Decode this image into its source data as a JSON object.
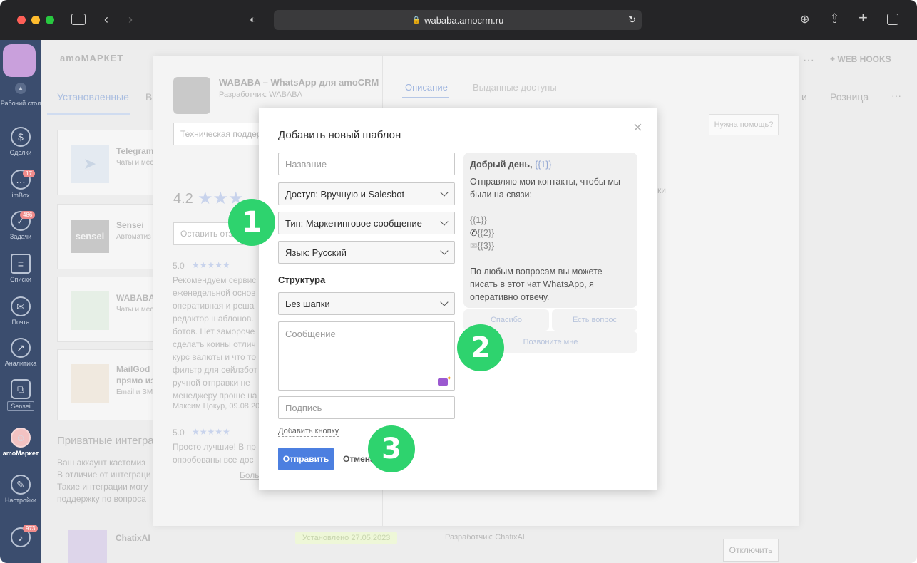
{
  "browser": {
    "url": "wababa.amocrm.ru"
  },
  "sidebar": {
    "items": [
      {
        "label": "Рабочий стол",
        "badge": ""
      },
      {
        "label": "Сделки",
        "badge": ""
      },
      {
        "label": "imBox",
        "badge": "17"
      },
      {
        "label": "Задачи",
        "badge": "486"
      },
      {
        "label": "Списки",
        "badge": ""
      },
      {
        "label": "Почта",
        "badge": ""
      },
      {
        "label": "Аналитика",
        "badge": ""
      },
      {
        "label": "Sensei",
        "badge": ""
      },
      {
        "label": "amoМаркет",
        "badge": ""
      },
      {
        "label": "Настройки",
        "badge": ""
      },
      {
        "label": "",
        "badge": "973"
      }
    ]
  },
  "market": {
    "title": "amoМАРКЕТ",
    "webhooks": "+ WEB HOOKS",
    "tab_installed": "Установленные",
    "tab_partial": "Вы",
    "tab_i": "и",
    "tab_retail": "Розница",
    "more": "···",
    "apps": [
      {
        "name": "Telegram",
        "sub": "Чаты и мес"
      },
      {
        "name": "Sensei",
        "sub": "Автоматиз",
        "logo": "sensei"
      },
      {
        "name": "WABABA",
        "sub": "Чаты и мес"
      },
      {
        "name": "MailGod",
        "name2": "прямо из",
        "sub": "Email и SM"
      }
    ],
    "private_title": "Приватные интегра",
    "private_lines": [
      "Ваш аккаунт кастомиз",
      "В отличие от интеграци",
      "Такие интеграции могу",
      "поддержку по вопроса"
    ],
    "chatix": {
      "name": "ChatixAI",
      "installed": "Установлено 27.05.2023",
      "dev": "Разработчик: ChatixAI",
      "button": "Отключить"
    }
  },
  "panel": {
    "app_title": "WABABA – WhatsApp для amoCRM",
    "developer": "Разработчик: WABABA",
    "support_button": "Техническая поддер",
    "rating": "4.2",
    "leave_review": "Оставить отзы",
    "tab_description": "Описание",
    "tab_access": "Выданные доступы",
    "help_button": "Нужна помощь?",
    "tab_partial_right": "лки",
    "review1": {
      "score": "5.0",
      "lines": [
        "Рекомендуем сервис",
        "еженедельной основ",
        "оперативная и реша",
        "редактор шаблонов.",
        "ботов. Нет замороче",
        "сделать коины отлич",
        "курс валюты и что то",
        "фильтр для сейлзбот",
        "ручной отправки не",
        "менеджеру проще на"
      ],
      "author": "Максим Цокур, 09.08.20"
    },
    "review2": {
      "score": "5.0",
      "lines": [
        "Просто лучшие! В пр",
        "опробованы все дос"
      ],
      "more": "Боль"
    }
  },
  "modal": {
    "title": "Добавить новый шаблон",
    "name_placeholder": "Название",
    "access": "Доступ: Вручную и Salesbot",
    "type": "Тип: Маркетинговое сообщение",
    "language": "Язык: Русский",
    "structure_label": "Структура",
    "header_option": "Без шапки",
    "message_placeholder": "Сообщение",
    "signature_placeholder": "Подпись",
    "add_button_link": "Добавить кнопку",
    "submit": "Отправить",
    "cancel": "Отмена",
    "close": "×",
    "preview": {
      "greeting": "Добрый день,",
      "greeting_var": "{{1}}",
      "line1": "Отправляю мои контакты, чтобы мы",
      "line2": "были на связи:",
      "var1": "{{1}}",
      "var2": "{{2}}",
      "var3": "{{3}}",
      "footer1": "По любым вопросам вы можете",
      "footer2": "писать в этот чат WhatsApp, я",
      "footer3": "оперативно отвечу.",
      "buttons": [
        "Спасибо",
        "Есть вопрос",
        "Позвоните мне"
      ]
    }
  },
  "annotations": [
    "1",
    "2",
    "3"
  ]
}
